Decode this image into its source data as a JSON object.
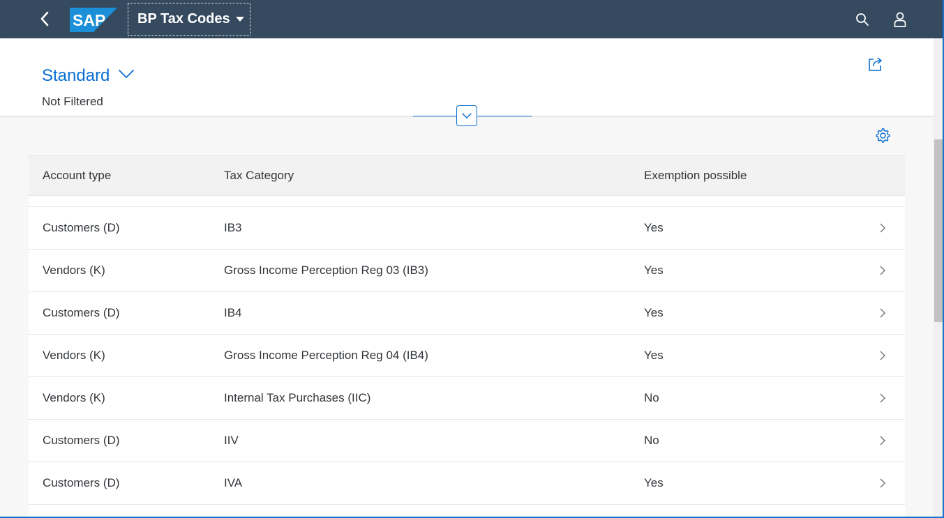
{
  "shell": {
    "app_title": "BP Tax Codes",
    "logo_text": "SAP",
    "icons": {
      "back": "back-arrow-icon",
      "search": "search-icon",
      "user": "user-icon"
    },
    "colors": {
      "shell_bg": "#354a5f",
      "logo_blue": "#1b8fd7"
    }
  },
  "header": {
    "variant_title": "Standard",
    "filter_status": "Not Filtered",
    "icons": {
      "share": "share-icon",
      "collapse": "chevron-down-icon"
    }
  },
  "table": {
    "settings_icon": "gear-icon",
    "columns": [
      "Account type",
      "Tax Category",
      "Exemption possible"
    ],
    "rows": [
      {
        "account_type": "Customers (D)",
        "tax_category": "IB3",
        "exemption": "Yes"
      },
      {
        "account_type": "Vendors (K)",
        "tax_category": "Gross Income Perception Reg 03 (IB3)",
        "exemption": "Yes"
      },
      {
        "account_type": "Customers (D)",
        "tax_category": "IB4",
        "exemption": "Yes"
      },
      {
        "account_type": "Vendors (K)",
        "tax_category": "Gross Income Perception Reg 04 (IB4)",
        "exemption": "Yes"
      },
      {
        "account_type": "Vendors (K)",
        "tax_category": "Internal Tax Purchases (IIC)",
        "exemption": "No"
      },
      {
        "account_type": "Customers (D)",
        "tax_category": "IIV",
        "exemption": "No"
      },
      {
        "account_type": "Customers (D)",
        "tax_category": "IVA",
        "exemption": "Yes"
      }
    ],
    "accent_color": "#0a6ed1"
  }
}
